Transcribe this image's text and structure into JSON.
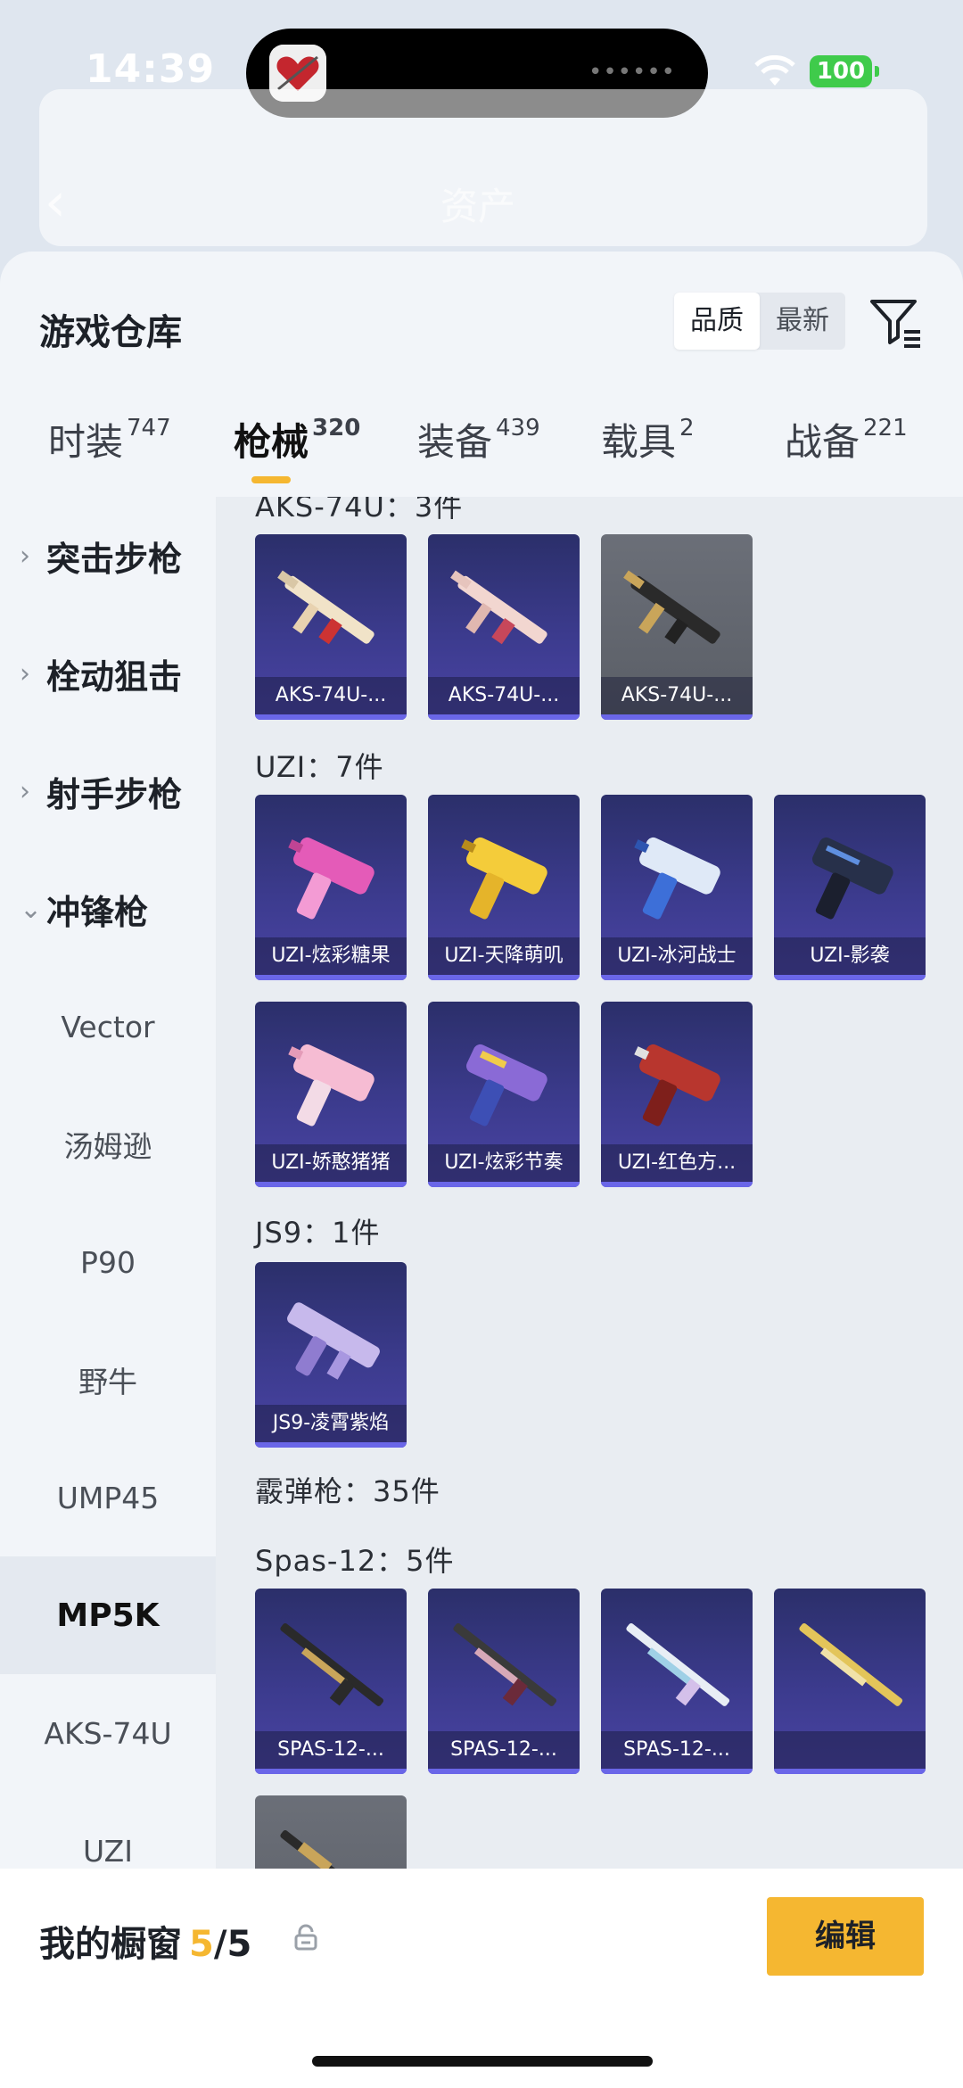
{
  "status_bar": {
    "time": "14:39",
    "battery": "100"
  },
  "header": {
    "title": "资产"
  },
  "panel": {
    "title": "游戏仓库",
    "sort_options": [
      "品质",
      "最新"
    ],
    "active_sort": "品质"
  },
  "tabs": [
    {
      "label": "时装",
      "count": "747"
    },
    {
      "label": "枪械",
      "count": "320"
    },
    {
      "label": "装备",
      "count": "439"
    },
    {
      "label": "载具",
      "count": "2"
    },
    {
      "label": "战备",
      "count": "221"
    }
  ],
  "sidebar": {
    "categories": [
      {
        "label": "突击步枪",
        "expanded": false
      },
      {
        "label": "栓动狙击",
        "expanded": false
      },
      {
        "label": "射手步枪",
        "expanded": false
      },
      {
        "label": "冲锋枪",
        "expanded": true
      }
    ],
    "subitems": [
      "Vector",
      "汤姆逊",
      "P90",
      "野牛",
      "UMP45",
      "MP5K",
      "AKS-74U",
      "UZI"
    ],
    "selected": "MP5K"
  },
  "groups": [
    {
      "label": "AKS-74U：3件",
      "items": [
        "AKS-74U-...",
        "AKS-74U-...",
        "AKS-74U-..."
      ]
    },
    {
      "label": "UZI：7件",
      "items": [
        "UZI-炫彩糖果",
        "UZI-天降萌叽",
        "UZI-冰河战士",
        "UZI-影袭",
        "UZI-娇憨猪猪",
        "UZI-炫彩节奏",
        "UZI-红色方..."
      ]
    },
    {
      "label": "JS9：1件",
      "items": [
        "JS9-凌霄紫焰"
      ]
    },
    {
      "label": "霰弹枪：35件",
      "items": []
    },
    {
      "label": "Spas-12：5件",
      "items": [
        "SPAS-12-...",
        "SPAS-12-...",
        "SPAS-12-...",
        ""
      ]
    }
  ],
  "bottom_bar": {
    "label": "我的橱窗",
    "current": "5",
    "total": "/5",
    "edit_label": "编辑"
  },
  "colors": {
    "accent": "#f5b731",
    "card_purple": "#3c3b8e",
    "card_gray": "#5a5e66"
  }
}
